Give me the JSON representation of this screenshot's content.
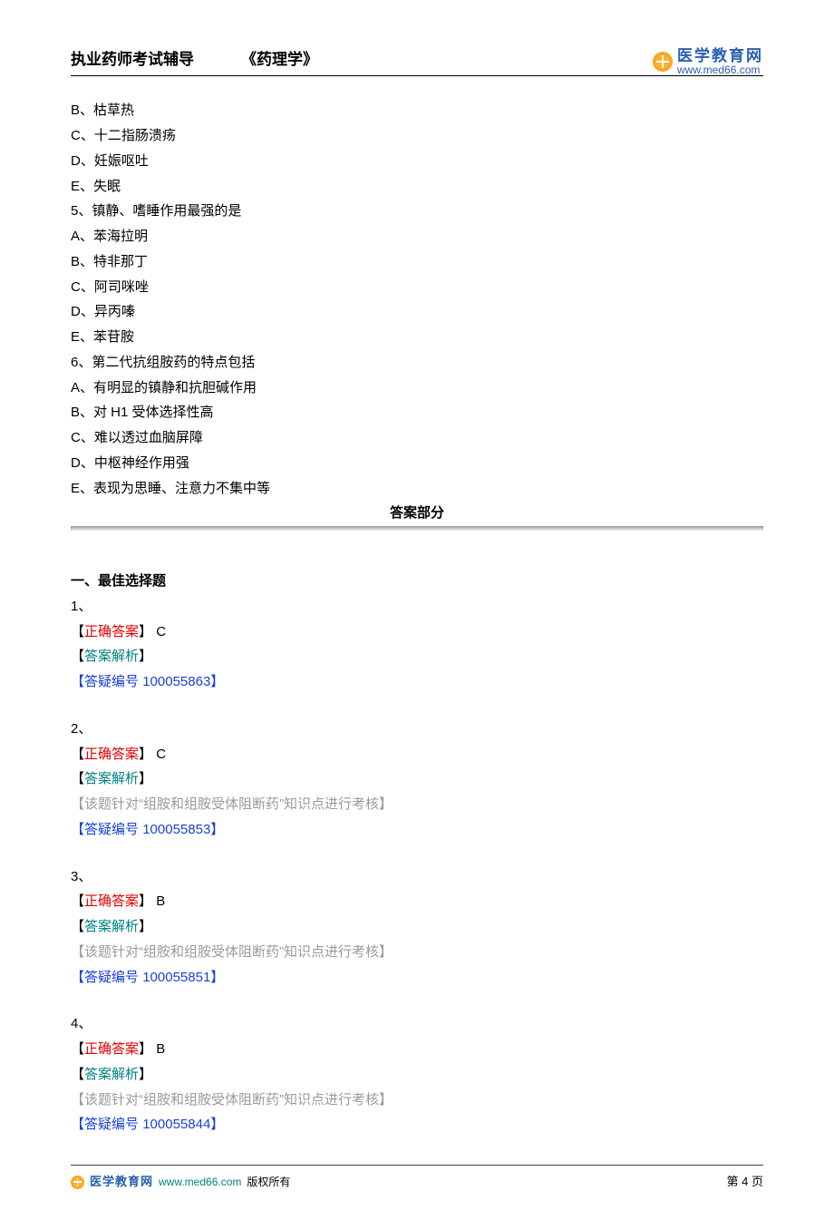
{
  "header": {
    "title_left": "执业药师考试辅导",
    "title_right": "《药理学》",
    "logo_cn": "医学教育网",
    "logo_url": "www.med66.com"
  },
  "questions_continued": [
    "B、枯草热",
    "C、十二指肠溃疡",
    "D、妊娠呕吐",
    "E、失眠"
  ],
  "q5": {
    "stem": "5、镇静、嗜睡作用最强的是",
    "opts": [
      "A、苯海拉明",
      "B、特非那丁",
      "C、阿司咪唑",
      "D、异丙嗪",
      "E、苯苷胺"
    ]
  },
  "q6": {
    "stem": "6、第二代抗组胺药的特点包括",
    "opts": [
      "A、有明显的镇静和抗胆碱作用",
      "B、对 H1 受体选择性高",
      "C、难以透过血脑屏障",
      "D、中枢神经作用强",
      "E、表现为思睡、注意力不集中等"
    ]
  },
  "answer_section_title": "答案部分",
  "choice_heading": "一、最佳选择题",
  "labels": {
    "correct": "正确答案",
    "analysis": "答案解析",
    "qid": "答疑编号"
  },
  "answers": [
    {
      "num": "1、",
      "letter": "C",
      "analysis": "",
      "qid": "100055863"
    },
    {
      "num": "2、",
      "letter": "C",
      "analysis": "【该题针对“组胺和组胺受体阻断药”知识点进行考核】",
      "qid": "100055853"
    },
    {
      "num": "3、",
      "letter": "B",
      "analysis": "【该题针对“组胺和组胺受体阻断药”知识点进行考核】",
      "qid": "100055851"
    },
    {
      "num": "4、",
      "letter": "B",
      "analysis": "【该题针对“组胺和组胺受体阻断药”知识点进行考核】",
      "qid": "100055844"
    }
  ],
  "footer": {
    "brand": "医学教育网",
    "url": "www.med66.com",
    "copyright": "版权所有",
    "page": "第 4 页"
  }
}
